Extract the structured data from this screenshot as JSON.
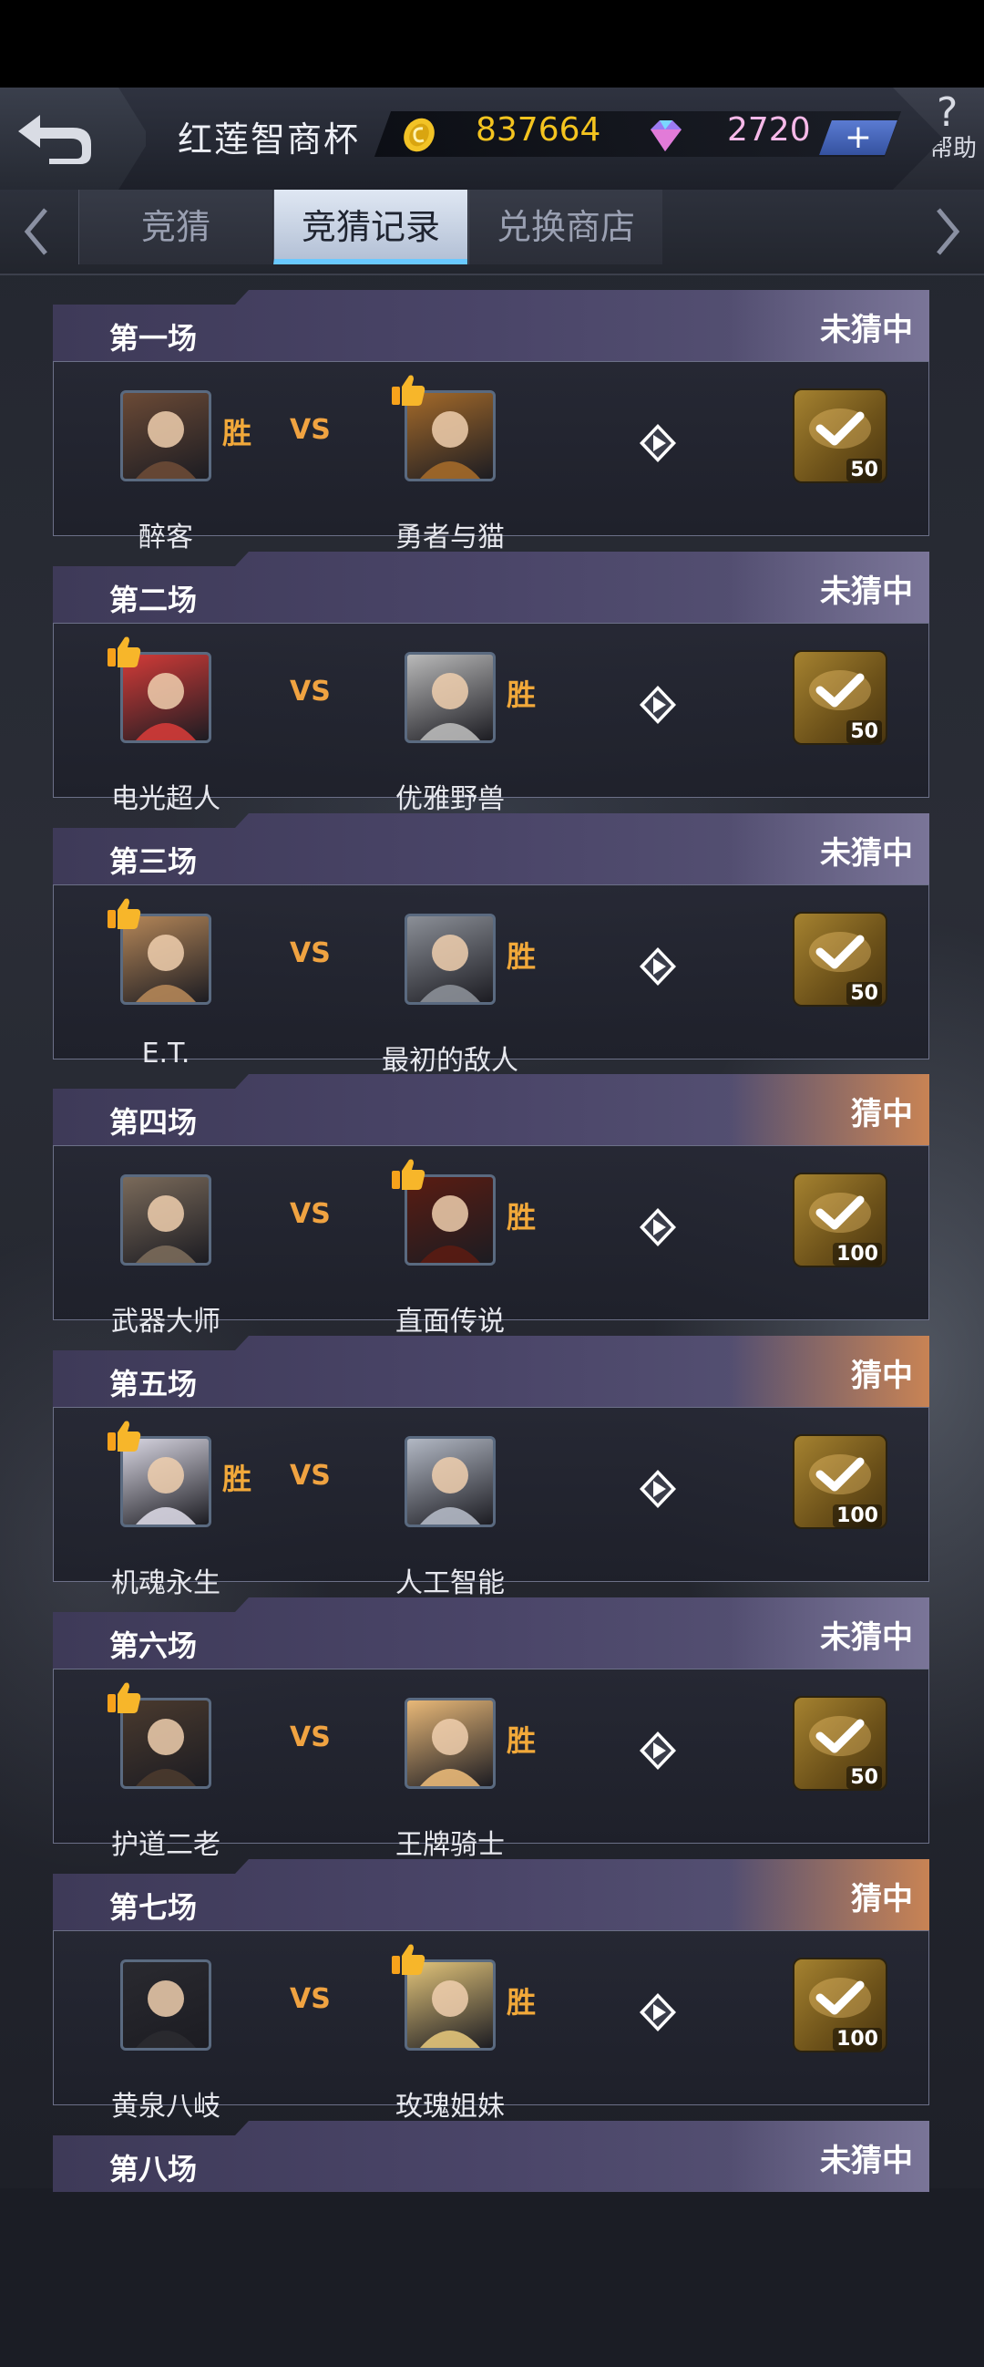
{
  "header": {
    "title": "红莲智商杯",
    "coins": "837664",
    "gems": "2720",
    "plus_label": "+",
    "help_label": "帮助",
    "help_symbol": "?"
  },
  "tabs": [
    {
      "label": "竞猜",
      "active": false
    },
    {
      "label": "竞猜记录",
      "active": true
    },
    {
      "label": "兑换商店",
      "active": false
    }
  ],
  "vs_label": "VS",
  "win_label": "胜",
  "matches": [
    {
      "title": "第一场",
      "status": "未猜中",
      "left": "醉客",
      "right": "勇者与猫",
      "winner": "left",
      "pick": "right",
      "reward": "50"
    },
    {
      "title": "第二场",
      "status": "未猜中",
      "left": "电光超人",
      "right": "优雅野兽",
      "winner": "right",
      "pick": "left",
      "reward": "50"
    },
    {
      "title": "第三场",
      "status": "未猜中",
      "left": "E.T.",
      "right": "最初的敌人",
      "winner": "right",
      "pick": "left",
      "reward": "50"
    },
    {
      "title": "第四场",
      "status": "猜中",
      "left": "武器大师",
      "right": "直面传说",
      "winner": "right",
      "pick": "right",
      "reward": "100"
    },
    {
      "title": "第五场",
      "status": "猜中",
      "left": "机魂永生",
      "right": "人工智能",
      "winner": "left",
      "pick": "left",
      "reward": "100"
    },
    {
      "title": "第六场",
      "status": "未猜中",
      "left": "护道二老",
      "right": "王牌骑士",
      "winner": "right",
      "pick": "left",
      "reward": "50"
    },
    {
      "title": "第七场",
      "status": "猜中",
      "left": "黄泉八岐",
      "right": "玫瑰姐妹",
      "winner": "right",
      "pick": "right",
      "reward": "100"
    },
    {
      "title": "第八场",
      "status": "未猜中"
    }
  ],
  "colors": {
    "coin": "#f4c41f",
    "gem": "#f7b9e9",
    "win": "#f2a93a",
    "hit_tag": "#c88354",
    "miss_tag": "#7a7598"
  }
}
